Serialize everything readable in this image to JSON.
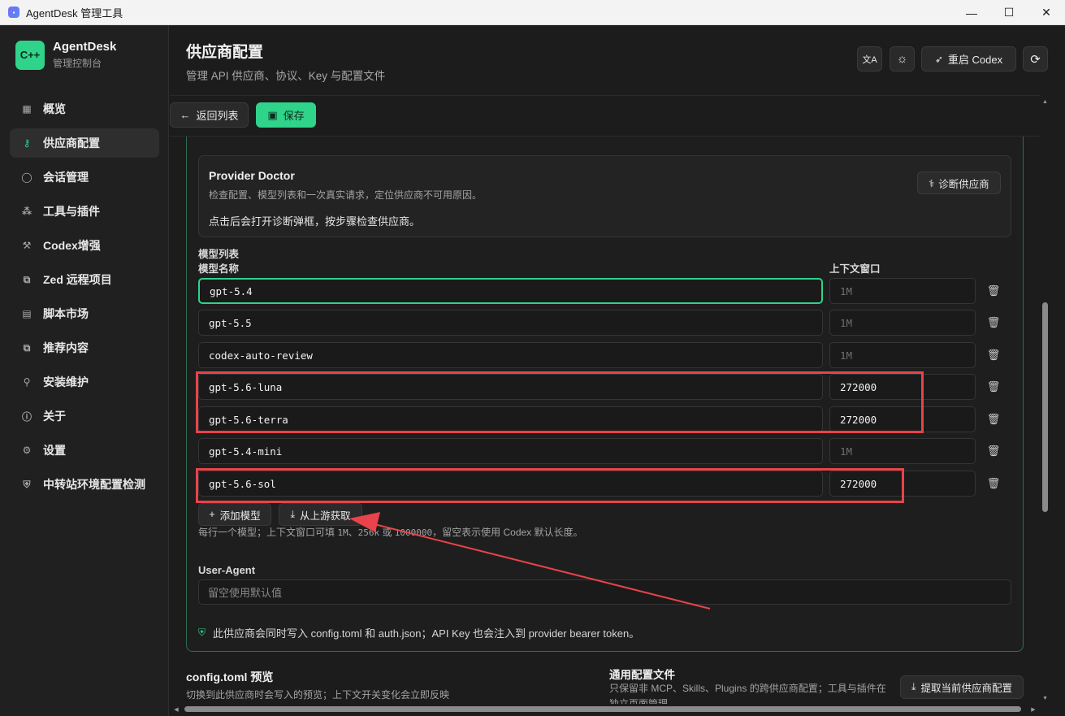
{
  "window": {
    "title": "AgentDesk 管理工具",
    "controls": {
      "minimize": "—",
      "maximize": "☐",
      "close": "✕"
    }
  },
  "brand": {
    "logo": "C++",
    "name": "AgentDesk",
    "subtitle": "管理控制台"
  },
  "sidebar": {
    "items": [
      {
        "label": "概览",
        "icon": "grid-icon",
        "glyph": "▦",
        "active": false
      },
      {
        "label": "供应商配置",
        "icon": "key-icon",
        "glyph": "⚷",
        "active": true
      },
      {
        "label": "会话管理",
        "icon": "chat-bubble-icon",
        "glyph": "◯",
        "active": false
      },
      {
        "label": "工具与插件",
        "icon": "network-icon",
        "glyph": "⁂",
        "active": false
      },
      {
        "label": "Codex增强",
        "icon": "hammer-icon",
        "glyph": "⚒",
        "active": false
      },
      {
        "label": "Zed 远程项目",
        "icon": "external-link-icon",
        "glyph": "⧉",
        "active": false
      },
      {
        "label": "脚本市场",
        "icon": "script-icon",
        "glyph": "▤",
        "active": false
      },
      {
        "label": "推荐内容",
        "icon": "external-link-icon",
        "glyph": "⧉",
        "active": false
      },
      {
        "label": "安装维护",
        "icon": "wrench-icon",
        "glyph": "⚲",
        "active": false
      },
      {
        "label": "关于",
        "icon": "info-icon",
        "glyph": "ⓘ",
        "active": false
      },
      {
        "label": "设置",
        "icon": "gear-icon",
        "glyph": "⚙",
        "active": false
      },
      {
        "label": "中转站环境配置检测",
        "icon": "shield-icon",
        "glyph": "⛨",
        "active": false
      }
    ]
  },
  "header": {
    "title": "供应商配置",
    "subtitle": "管理 API 供应商、协议、Key 与配置文件",
    "translate_glyph": "文A",
    "theme_glyph": "☼",
    "restart_label": "重启 Codex",
    "restart_glyph": "➶",
    "refresh_glyph": "⟳"
  },
  "toolbar": {
    "back_label": "返回列表",
    "back_glyph": "←",
    "save_label": "保存",
    "save_glyph": "▣"
  },
  "doctor": {
    "title": "Provider Doctor",
    "description": "检查配置、模型列表和一次真实请求，定位供应商不可用原因。",
    "note": "点击后会打开诊断弹框，按步骤检查供应商。",
    "button_label": "诊断供应商",
    "button_glyph": "⚕"
  },
  "models": {
    "section_label": "模型列表",
    "name_header": "模型名称",
    "context_header": "上下文窗口",
    "context_placeholder": "1M",
    "delete_glyph": "🗑",
    "rows": [
      {
        "name": "gpt-5.4",
        "context": ""
      },
      {
        "name": "gpt-5.5",
        "context": ""
      },
      {
        "name": "codex-auto-review",
        "context": ""
      },
      {
        "name": "gpt-5.6-luna",
        "context": "272000"
      },
      {
        "name": "gpt-5.6-terra",
        "context": "272000"
      },
      {
        "name": "gpt-5.4-mini",
        "context": ""
      },
      {
        "name": "gpt-5.6-sol",
        "context": "272000"
      }
    ],
    "add_label": "添加模型",
    "add_glyph": "+",
    "fetch_label": "从上游获取",
    "fetch_glyph": "⤓",
    "hint_prefix": "每行一个模型；上下文窗口可填 ",
    "hint_mono1": "1M",
    "hint_mid": "、",
    "hint_mono2": "256k",
    "hint_or": " 或 ",
    "hint_mono3": "1000000",
    "hint_suffix": "，留空表示使用 Codex 默认长度。"
  },
  "user_agent": {
    "label": "User-Agent",
    "placeholder": "留空使用默认值"
  },
  "info": {
    "text": "此供应商会同时写入 config.toml 和 auth.json；API Key 也会注入到 provider bearer token。",
    "glyph": "⛨"
  },
  "config_preview": {
    "title": "config.toml 预览",
    "subtitle": "切换到此供应商时会写入的预览；上下文开关变化会立即反映"
  },
  "common_config": {
    "title": "通用配置文件",
    "subtitle": "只保留非 MCP、Skills、Plugins 的跨供应商配置；工具与插件在独立页面管理。",
    "extract_label": "提取当前供应商配置",
    "extract_glyph": "⤓"
  },
  "colors": {
    "accent": "#2fd38a",
    "annotation": "#e8434a",
    "background": "#1c1c1c"
  }
}
